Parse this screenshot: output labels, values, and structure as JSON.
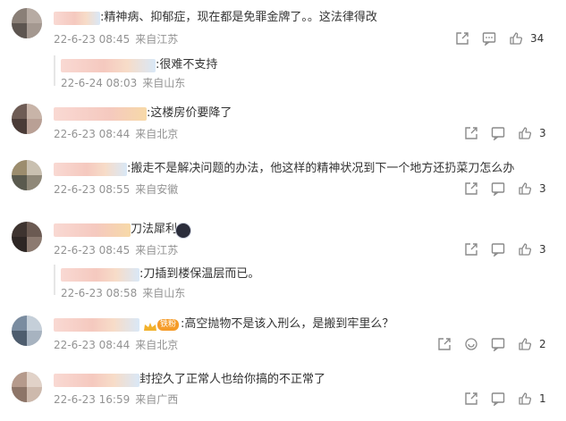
{
  "comments": [
    {
      "text": ":精神病、抑郁症，现在都是免罪金牌了。。这法律得改",
      "date": "22-6-23 08:45",
      "location": "来自江苏",
      "likes": "34",
      "has_comment_icon": true
    },
    {
      "text": ":很难不支持",
      "date": "22-6-24 08:03",
      "location": "来自山东"
    },
    {
      "text": ":这楼房价要降了",
      "date": "22-6-23 08:44",
      "location": "来自北京",
      "likes": "3"
    },
    {
      "text": ":搬走不是解决问题的办法，他这样的精神状况到下一个地方还扔菜刀怎么办",
      "date": "22-6-23 08:55",
      "location": "来自安徽",
      "likes": "3"
    },
    {
      "text": "刀法犀利",
      "date": "22-6-23 08:45",
      "location": "来自江苏",
      "likes": "3"
    },
    {
      "text": ":刀插到楼保温层而已。",
      "date": "22-6-23 08:58",
      "location": "来自山东"
    },
    {
      "text": ":高空抛物不是该入刑么，是搬到牢里么？",
      "date": "22-6-23 08:44",
      "location": "来自北京",
      "likes": "2",
      "badge": "铁粉"
    },
    {
      "text": "封控久了正常人也给你搞的不正常了",
      "date": "22-6-23 16:59",
      "location": "来自广西",
      "likes": "1"
    }
  ],
  "colors": {
    "meta": "#939393",
    "text": "#333333",
    "icon": "#8a8a8a",
    "badge": "#f59c2a"
  },
  "icons": [
    "share-icon",
    "comment-icon",
    "like-icon",
    "emoji-icon",
    "crown-icon"
  ]
}
